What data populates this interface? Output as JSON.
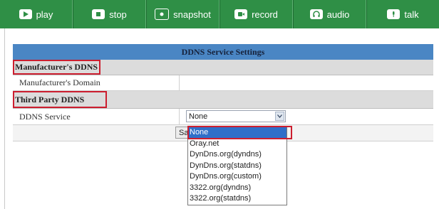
{
  "toolbar": {
    "buttons": [
      {
        "label": "play",
        "icon": "play-icon"
      },
      {
        "label": "stop",
        "icon": "stop-icon"
      },
      {
        "label": "snapshot",
        "icon": "camera-icon"
      },
      {
        "label": "record",
        "icon": "record-icon"
      },
      {
        "label": "audio",
        "icon": "audio-icon"
      },
      {
        "label": "talk",
        "icon": "talk-icon"
      }
    ]
  },
  "panel": {
    "title": "DDNS Service Settings",
    "manufacturer_section": "Manufacturer's DDNS",
    "manufacturer_domain_label": "Manufacturer's Domain",
    "manufacturer_domain_value": "",
    "third_party_section": "Third Party DDNS",
    "ddns_service_label": "DDNS Service",
    "ddns_service_value": "None",
    "save_button_label": "Save"
  },
  "dropdown": {
    "options": [
      "None",
      "Oray.net",
      "DynDns.org(dyndns)",
      "DynDns.org(statdns)",
      "DynDns.org(custom)",
      "3322.org(dyndns)",
      "3322.org(statdns)"
    ],
    "selected_index": 0
  },
  "colors": {
    "toolbar_bg": "#2f8f46",
    "panel_title_bg": "#4a86c4",
    "highlight": "#cc1e2f",
    "selected_option_bg": "#2f6fc9"
  }
}
